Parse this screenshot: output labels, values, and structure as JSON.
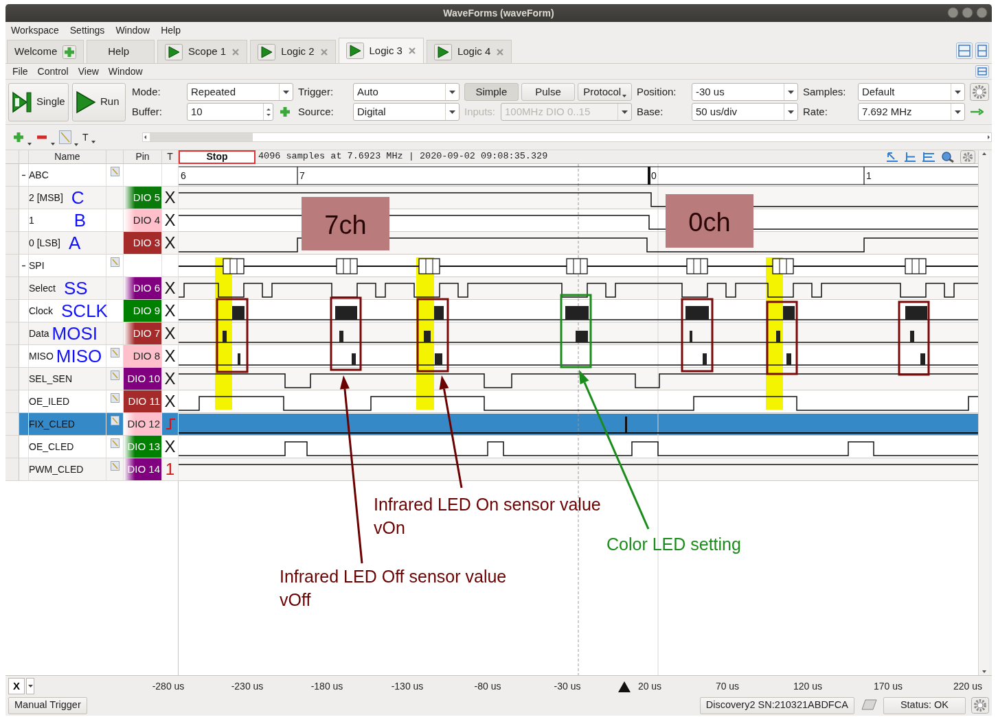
{
  "window": {
    "title": "WaveForms (waveForm)"
  },
  "menu": [
    {
      "label": "Workspace"
    },
    {
      "label": "Settings"
    },
    {
      "label": "Window"
    },
    {
      "label": "Help"
    }
  ],
  "tabs": [
    {
      "label": "Welcome",
      "kind": "add",
      "selected": false
    },
    {
      "label": "Help",
      "kind": "plain",
      "selected": false
    },
    {
      "label": "Scope 1",
      "kind": "instrument",
      "selected": false
    },
    {
      "label": "Logic 2",
      "kind": "instrument",
      "selected": false
    },
    {
      "label": "Logic 3",
      "kind": "instrument",
      "selected": true
    },
    {
      "label": "Logic 4",
      "kind": "instrument",
      "selected": false
    }
  ],
  "submenu": [
    {
      "label": "File"
    },
    {
      "label": "Control"
    },
    {
      "label": "View"
    },
    {
      "label": "Window"
    }
  ],
  "toolbar": {
    "single": "Single",
    "run": "Run",
    "mode": {
      "label": "Mode:",
      "value": "Repeated"
    },
    "buffer": {
      "label": "Buffer:",
      "value": "10"
    },
    "trigger": {
      "label": "Trigger:",
      "value": "Auto"
    },
    "source": {
      "label": "Source:",
      "value": "Digital"
    },
    "trigger_types": [
      {
        "label": "Simple",
        "selected": true
      },
      {
        "label": "Pulse",
        "selected": false
      },
      {
        "label": "Protocol",
        "selected": false
      }
    ],
    "inputs": {
      "label": "Inputs:",
      "value": "100MHz DIO 0..15",
      "disabled": true
    },
    "position": {
      "label": "Position:",
      "value": "-30 us"
    },
    "base": {
      "label": "Base:",
      "value": "50 us/div"
    },
    "samples": {
      "label": "Samples:",
      "value": "Default"
    },
    "rate": {
      "label": "Rate:",
      "value": "7.692 MHz"
    }
  },
  "tools": {
    "text_tool": "T"
  },
  "table": {
    "columns": [
      "Name",
      "Pin",
      "T"
    ]
  },
  "channels": [
    {
      "name": "ABC",
      "kind": "bus",
      "expanded": true,
      "editable": true,
      "selected": false,
      "bus_values": [
        "6",
        "7",
        "0",
        "1"
      ],
      "children": [
        {
          "name": "2 [MSB]",
          "annotation": "C",
          "pin": "DIO 5",
          "color": "#0a7a0a",
          "fade": true,
          "editable": false,
          "selected": false,
          "trigger": {
            "kind": "dont_care",
            "text": "X"
          }
        },
        {
          "name": "1",
          "annotation": "B",
          "pin": "DIO 4",
          "color": "#ffc0cb",
          "fade": true,
          "editable": false,
          "selected": false,
          "trigger": {
            "kind": "dont_care",
            "text": "X"
          }
        },
        {
          "name": "0 [LSB]",
          "annotation": "A",
          "pin": "DIO 3",
          "color": "#a52a2a",
          "fade": false,
          "editable": false,
          "selected": false,
          "trigger": {
            "kind": "dont_care",
            "text": "X"
          }
        }
      ]
    },
    {
      "name": "SPI",
      "kind": "bus",
      "expanded": true,
      "editable": true,
      "selected": false,
      "children": [
        {
          "name": "Select",
          "annotation": "SS",
          "pin": "DIO 6",
          "color": "#800080",
          "fade": true,
          "editable": false,
          "selected": false,
          "trigger": {
            "kind": "dont_care",
            "text": "X"
          }
        },
        {
          "name": "Clock",
          "annotation": "SCLK",
          "pin": "DIO 9",
          "color": "#008000",
          "fade": false,
          "editable": false,
          "selected": false,
          "trigger": {
            "kind": "dont_care",
            "text": "X"
          }
        },
        {
          "name": "Data",
          "annotation": "MOSI",
          "pin": "DIO 7",
          "color": "#a52a2a",
          "fade": true,
          "editable": false,
          "selected": false,
          "trigger": {
            "kind": "dont_care",
            "text": "X"
          }
        },
        {
          "name": "MISO",
          "annotation": "MISO",
          "pin": "DIO 8",
          "color": "#ffc0cb",
          "fade": false,
          "editable": true,
          "selected": false,
          "trigger": {
            "kind": "dont_care",
            "text": "X"
          }
        }
      ]
    },
    {
      "name": "SEL_SEN",
      "kind": "signal",
      "pin": "DIO 10",
      "color": "#800080",
      "fade": false,
      "editable": true,
      "selected": false,
      "trigger": {
        "kind": "dont_care",
        "text": "X"
      }
    },
    {
      "name": "OE_ILED",
      "kind": "signal",
      "pin": "DIO 11",
      "color": "#a52a2a",
      "fade": false,
      "editable": true,
      "selected": false,
      "trigger": {
        "kind": "dont_care",
        "text": "X"
      }
    },
    {
      "name": "FIX_CLED",
      "kind": "signal",
      "pin": "DIO 12",
      "color": "#ffc0cb",
      "fade": true,
      "editable": true,
      "selected": true,
      "trigger": {
        "kind": "rise"
      }
    },
    {
      "name": "OE_CLED",
      "kind": "signal",
      "pin": "DIO 13",
      "color": "#008000",
      "fade": true,
      "editable": true,
      "selected": false,
      "trigger": {
        "kind": "dont_care",
        "text": "X"
      }
    },
    {
      "name": "PWM_CLED",
      "kind": "signal",
      "pin": "DIO 14",
      "color": "#800080",
      "fade": true,
      "editable": true,
      "selected": false,
      "trigger": {
        "kind": "high",
        "text": "1"
      }
    }
  ],
  "plot": {
    "stop": "Stop",
    "info": "4096 samples at 7.6923 MHz | 2020-09-02 09:08:35.329",
    "labels": [
      {
        "text": "7ch"
      },
      {
        "text": "0ch"
      }
    ],
    "notes": [
      {
        "lines": [
          "Infrared LED On sensor value",
          "vOn"
        ],
        "color": "#6b0000"
      },
      {
        "lines": [
          "Color LED setting"
        ],
        "color": "#1a8c1a"
      },
      {
        "lines": [
          "Infrared LED Off sensor value",
          "vOff"
        ],
        "color": "#6b0000"
      }
    ]
  },
  "x_axis": {
    "button": "X",
    "labels": [
      "-280 us",
      "-230 us",
      "-180 us",
      "-130 us",
      "-80 us",
      "-30 us",
      "20 us",
      "70 us",
      "120 us",
      "170 us",
      "220 us"
    ]
  },
  "status_bar": {
    "trigger": "Manual Trigger",
    "device": "Discovery2 SN:210321ABDFCA",
    "status": "Status: OK"
  }
}
